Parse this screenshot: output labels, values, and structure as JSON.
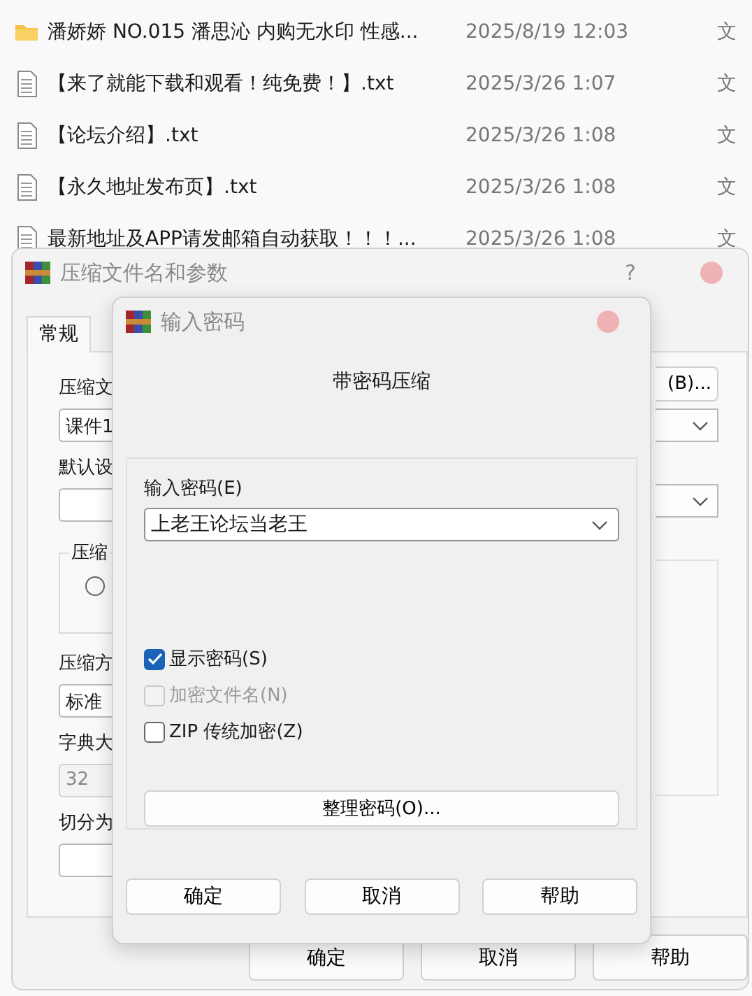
{
  "file_list": [
    {
      "kind": "folder",
      "name": "潘娇娇 NO.015 潘思沁 内购无水印 性感...",
      "date": "2025/8/19 12:03",
      "type": "文"
    },
    {
      "kind": "text",
      "name": "【来了就能下载和观看！纯免费！】.txt",
      "date": "2025/3/26 1:07",
      "type": "文"
    },
    {
      "kind": "text",
      "name": "【论坛介绍】.txt",
      "date": "2025/3/26 1:08",
      "type": "文"
    },
    {
      "kind": "text",
      "name": "【永久地址发布页】.txt",
      "date": "2025/3/26 1:08",
      "type": "文"
    },
    {
      "kind": "text",
      "name": "最新地址及APP请发邮箱自动获取！！！...",
      "date": "2025/3/26 1:08",
      "type": "文"
    }
  ],
  "back_dialog": {
    "title": "压缩文件名和参数",
    "help": "?",
    "tabs": [
      {
        "label": "常规",
        "selected": true
      }
    ],
    "left_column": [
      {
        "kind": "label",
        "text": "压缩文"
      },
      {
        "kind": "field",
        "value": "课件1"
      },
      {
        "kind": "label",
        "text": "默认设"
      },
      {
        "kind": "field"
      },
      {
        "kind": "group",
        "title": "压缩",
        "radio_selected": false
      },
      {
        "kind": "label",
        "text": "压缩方"
      },
      {
        "kind": "field",
        "value": "标准"
      },
      {
        "kind": "label",
        "text": "字典大"
      },
      {
        "kind": "disabled_field",
        "value": "32"
      },
      {
        "kind": "label",
        "text": "切分为"
      },
      {
        "kind": "field"
      }
    ],
    "right_column": [
      {
        "kind": "button",
        "label": "(B)..."
      },
      {
        "kind": "dropdown"
      },
      {
        "kind": "dropdown"
      },
      {
        "kind": "group"
      }
    ],
    "buttons": [
      "确定",
      "取消",
      "帮助"
    ]
  },
  "front_dialog": {
    "title": "输入密码",
    "heading": "带密码压缩",
    "password_label": "输入密码(E)",
    "password_value": "上老王论坛当老王",
    "checkboxes": [
      {
        "label": "显示密码(S)",
        "checked": true,
        "disabled": false
      },
      {
        "label": "加密文件名(N)",
        "checked": false,
        "disabled": true
      },
      {
        "label": "ZIP 传统加密(Z)",
        "checked": false,
        "disabled": false
      }
    ],
    "organize_button": "整理密码(O)...",
    "buttons": [
      "确定",
      "取消",
      "帮助"
    ]
  }
}
